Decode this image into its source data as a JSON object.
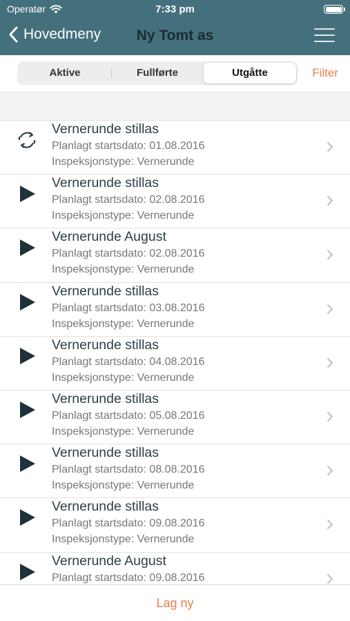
{
  "status": {
    "carrier": "Operatør",
    "time": "7:33 pm"
  },
  "nav": {
    "back_label": "Hovedmeny",
    "title": "Ny Tomt as"
  },
  "segments": [
    {
      "label": "Aktive",
      "active": false
    },
    {
      "label": "Fullførte",
      "active": false
    },
    {
      "label": "Utgåtte",
      "active": true
    }
  ],
  "filter_label": "Filter",
  "items": [
    {
      "icon": "sync-icon",
      "title": "Vernerunde stillas",
      "date_line": "Planlagt startsdato: 01.08.2016",
      "type_line": "Inspeksjonstype: Vernerunde"
    },
    {
      "icon": "play-icon",
      "title": "Vernerunde stillas",
      "date_line": "Planlagt startsdato: 02.08.2016",
      "type_line": "Inspeksjonstype: Vernerunde"
    },
    {
      "icon": "play-icon",
      "title": "Vernerunde August",
      "date_line": "Planlagt startsdato: 02.08.2016",
      "type_line": "Inspeksjonstype: Vernerunde"
    },
    {
      "icon": "play-icon",
      "title": "Vernerunde stillas",
      "date_line": "Planlagt startsdato: 03.08.2016",
      "type_line": "Inspeksjonstype: Vernerunde"
    },
    {
      "icon": "play-icon",
      "title": "Vernerunde stillas",
      "date_line": "Planlagt startsdato: 04.08.2016",
      "type_line": "Inspeksjonstype: Vernerunde"
    },
    {
      "icon": "play-icon",
      "title": "Vernerunde stillas",
      "date_line": "Planlagt startsdato: 05.08.2016",
      "type_line": "Inspeksjonstype: Vernerunde"
    },
    {
      "icon": "play-icon",
      "title": "Vernerunde stillas",
      "date_line": "Planlagt startsdato: 08.08.2016",
      "type_line": "Inspeksjonstype: Vernerunde"
    },
    {
      "icon": "play-icon",
      "title": "Vernerunde stillas",
      "date_line": "Planlagt startsdato: 09.08.2016",
      "type_line": "Inspeksjonstype: Vernerunde"
    },
    {
      "icon": "play-icon",
      "title": "Vernerunde August",
      "date_line": "Planlagt startsdato: 09.08.2016",
      "type_line": ""
    }
  ],
  "bottom": {
    "new_label": "Lag ny"
  },
  "colors": {
    "nav_bg": "#44707d",
    "accent": "#e8814b",
    "title_dark": "#1b2b33"
  }
}
